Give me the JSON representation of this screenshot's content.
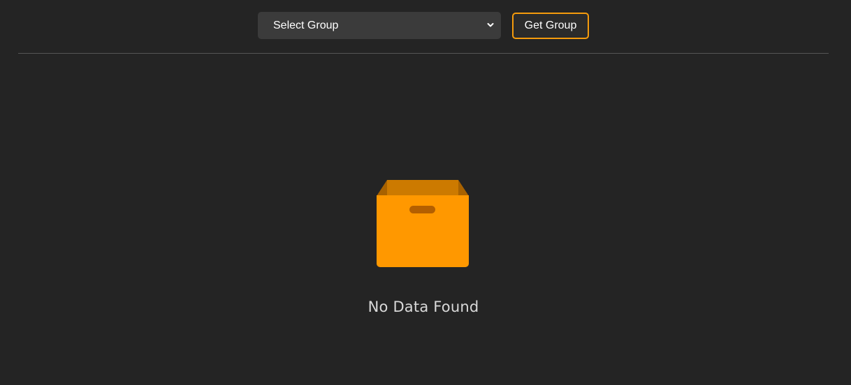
{
  "toolbar": {
    "group_select": {
      "selected_label": "Select Group"
    },
    "get_group_label": "Get Group"
  },
  "empty_state": {
    "icon": "empty-box-icon",
    "message": "No Data Found"
  },
  "colors": {
    "background": "#242424",
    "select_background": "#3b3b3b",
    "accent": "#f59b0c",
    "box_front": "#ff9800",
    "box_inner": "#cc7a00",
    "text_muted": "#d9d9d9"
  }
}
